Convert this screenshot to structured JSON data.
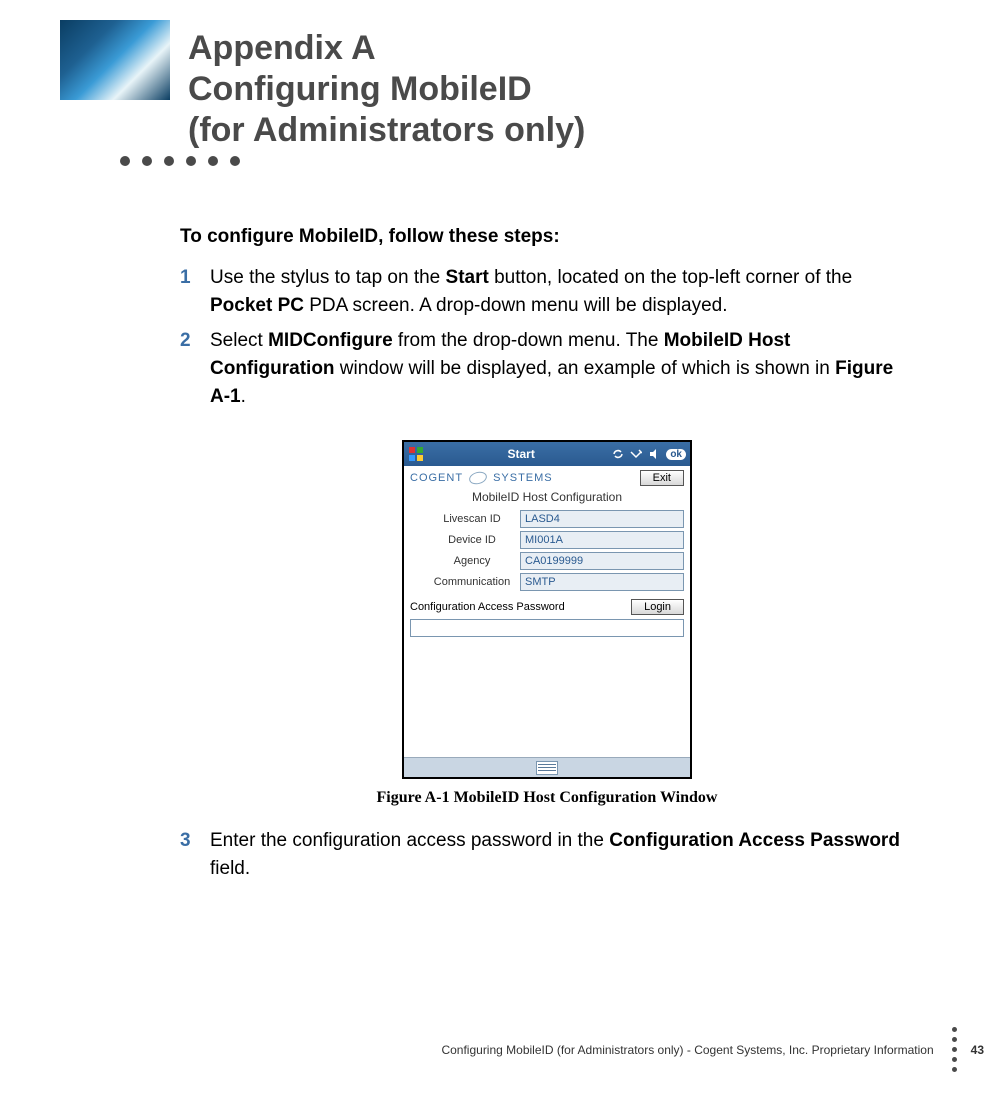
{
  "header": {
    "title_line1": "Appendix A",
    "title_line2": "Configuring MobileID",
    "title_line3": "(for Administrators only)"
  },
  "intro": "To configure MobileID, follow these steps:",
  "steps": {
    "s1": {
      "num": "1",
      "pre": "Use the stylus to tap on the ",
      "b1": "Start",
      "mid1": " button, located on the top-left corner of the ",
      "b2": "Pocket PC",
      "post": " PDA screen. A drop-down menu will be displayed."
    },
    "s2": {
      "num": "2",
      "pre": "Select ",
      "b1": "MIDConfigure",
      "mid1": " from the drop-down menu. The ",
      "b2": "MobileID Host Configuration",
      "mid2": " window will be displayed, an example of which is shown in ",
      "b3": "Figure A-1",
      "post": "."
    },
    "s3": {
      "num": "3",
      "pre": "Enter the configuration access password in the ",
      "b1": "Configuration Access Password",
      "post": " field."
    }
  },
  "figure": {
    "caption": "Figure A-1 MobileID Host Configuration Window"
  },
  "ppc": {
    "titlebar": "Start",
    "ok": "ok",
    "logo_left": "COGENT",
    "logo_right": "SYSTEMS",
    "exit_btn": "Exit",
    "section_title": "MobileID Host Configuration",
    "fields": {
      "livescan": {
        "label": "Livescan ID",
        "value": "LASD4"
      },
      "device": {
        "label": "Device ID",
        "value": "MI001A"
      },
      "agency": {
        "label": "Agency",
        "value": "CA0199999"
      },
      "comm": {
        "label": "Communication",
        "value": "SMTP"
      }
    },
    "cap_label": "Configuration Access Password",
    "login_btn": "Login"
  },
  "footer": {
    "text": "Configuring MobileID (for Administrators only)  - Cogent Systems, Inc. Proprietary Information",
    "page": "43"
  }
}
